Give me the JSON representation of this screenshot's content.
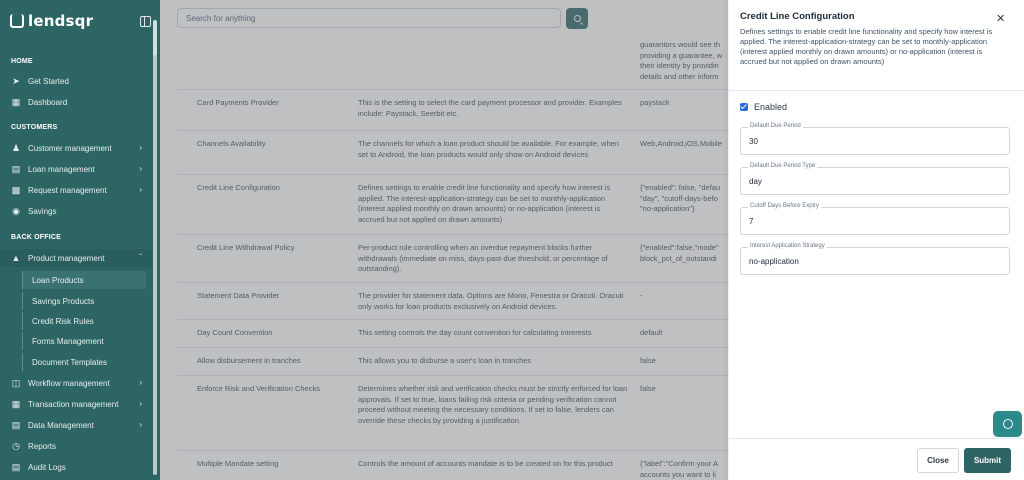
{
  "brand": {
    "name": "lendsqr"
  },
  "search": {
    "placeholder": "Search for anything"
  },
  "sidebar": {
    "sections": {
      "home": "HOME",
      "customers": "CUSTOMERS",
      "back_office": "BACK OFFICE"
    },
    "items": {
      "get_started": "Get Started",
      "dashboard": "Dashboard",
      "customer_management": "Customer management",
      "loan_management": "Loan management",
      "request_management": "Request management",
      "savings": "Savings",
      "product_management": "Product management",
      "workflow_management": "Workflow management",
      "transaction_management": "Transaction management",
      "data_management": "Data Management",
      "reports": "Reports",
      "audit_logs": "Audit Logs"
    },
    "sub_items": {
      "loan_products": "Loan Products",
      "savings_products": "Savings Products",
      "credit_risk_rules": "Credit Risk Rules",
      "forms_management": "Forms Management",
      "document_templates": "Document Templates"
    }
  },
  "table": {
    "top_partial": "guarantors would see th\nproviding a guarantee, w\ntheir identity by providin\ndetails and other inform",
    "rows": [
      {
        "name": "Card Payments Provider",
        "description": "This is the setting to select the card payment processor and provider. Examples include: Paystack, Seerbit etc.",
        "value": "paystack"
      },
      {
        "name": "Channels Availability",
        "description": "The channels for which a loan product should be available. For example, when set to Android, the loan products would only show on Android devices",
        "value": "Web,Android,iOS,Mobile"
      },
      {
        "name": "Credit Line Configuration",
        "description": "Defines settings to enable credit line functionality and specify how interest is applied. The interest-application-strategy can be set to monthly-application (interest applied monthly on drawn amounts) or no-application (interest is accrued but not applied on drawn amounts)",
        "value": "{\"enabled\": false, \"defau\n\"day\", \"cutoff-days-befo\n\"no-application\"}"
      },
      {
        "name": "Credit Line Withdrawal Policy",
        "description": "Per-product rule controlling when an overdue repayment blocks further withdrawals (immediate on miss, days-past-due threshold, or percentage of outstanding).",
        "value": "{\"enabled\":false,\"mode\"\nblock_pct_of_outstandi"
      },
      {
        "name": "Statement Data Provider",
        "description": "The provider for statement data. Options are Mono, Fenestra or Oracuti. Oracuti only works for loan products exclusively on Android devices.",
        "value": "-"
      },
      {
        "name": "Day Count Convention",
        "description": "This setting controls the day count convention for calculating intrerests",
        "value": "default"
      },
      {
        "name": "Allow disbursement in tranches",
        "description": "This allows you to disburse a user's loan in tranches",
        "value": "false"
      },
      {
        "name": "Enforce Risk and Verification Checks",
        "description": "Determines whether risk and verification checks must be strictly enforced for loan approvals. If set to true, loans failing risk criteria or pending verification cannot proceed without meeting the necessary conditions. If set to false, lenders can override these checks by providing a justification.",
        "value": "false"
      },
      {
        "name": "Multiple Mandate setting",
        "description": "Controls the amount of accounts mandate is to be created on for this product",
        "value": "{\"label\":\"Confirm your A\naccounts you want to li"
      }
    ]
  },
  "panel": {
    "title": "Credit Line Configuration",
    "description": "Defines settings to enable credit line functionality and specify how interest is applied. The interest-application-strategy can be set to monthly-application (interest applied monthly on drawn amounts) or no-application (interest is accrued but not applied on drawn amounts)",
    "enabled_label": "Enabled",
    "fields": [
      {
        "label": "Default Due Period",
        "value": "30"
      },
      {
        "label": "Default Due Period Type",
        "value": "day"
      },
      {
        "label": "Cutoff Days Before Expiry",
        "value": "7"
      },
      {
        "label": "Interest Application Strategy",
        "value": "no-application"
      }
    ],
    "close_label": "Close",
    "submit_label": "Submit"
  }
}
